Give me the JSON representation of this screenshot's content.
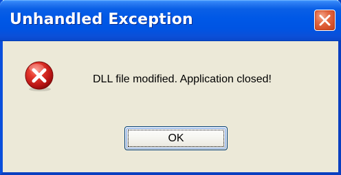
{
  "dialog": {
    "title": "Unhandled Exception",
    "message": "DLL file modified. Application closed!",
    "ok_label": "OK",
    "icon": "error-icon",
    "close_icon": "close-icon"
  },
  "colors": {
    "titlebar": "#0054e3",
    "body": "#ece9d8",
    "close_button": "#d5502a",
    "error_icon": "#d41f1f"
  }
}
